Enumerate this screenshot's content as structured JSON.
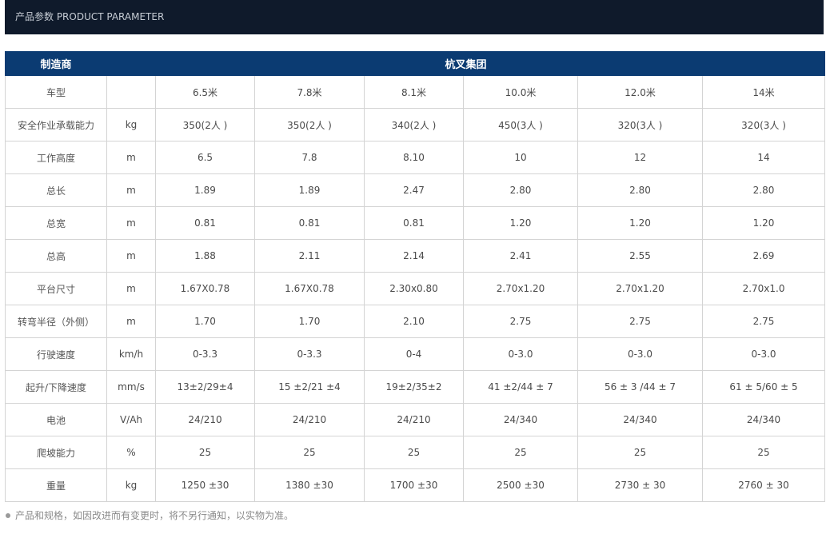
{
  "header": {
    "title": "产品参数 PRODUCT PARAMETER"
  },
  "table": {
    "manufacturer_label": "制造商",
    "manufacturer_value": "杭叉集团",
    "rows": [
      {
        "label": "车型",
        "unit": "",
        "values": [
          "6.5米",
          "7.8米",
          "8.1米",
          "10.0米",
          "12.0米",
          "14米"
        ]
      },
      {
        "label": "安全作业承载能力",
        "unit": "kg",
        "values": [
          "350(2人 )",
          "350(2人 )",
          "340(2人 )",
          "450(3人 )",
          "320(3人 )",
          "320(3人 )"
        ]
      },
      {
        "label": "工作高度",
        "unit": "m",
        "values": [
          "6.5",
          "7.8",
          "8.10",
          "10",
          "12",
          "14"
        ]
      },
      {
        "label": "总长",
        "unit": "m",
        "values": [
          "1.89",
          "1.89",
          "2.47",
          "2.80",
          "2.80",
          "2.80"
        ]
      },
      {
        "label": "总宽",
        "unit": "m",
        "values": [
          "0.81",
          "0.81",
          "0.81",
          "1.20",
          "1.20",
          "1.20"
        ]
      },
      {
        "label": "总高",
        "unit": "m",
        "values": [
          "1.88",
          "2.11",
          "2.14",
          "2.41",
          "2.55",
          "2.69"
        ]
      },
      {
        "label": "平台尺寸",
        "unit": "m",
        "values": [
          "1.67X0.78",
          "1.67X0.78",
          "2.30x0.80",
          "2.70x1.20",
          "2.70x1.20",
          "2.70x1.0"
        ]
      },
      {
        "label": "转弯半径（外侧）",
        "unit": "m",
        "values": [
          "1.70",
          "1.70",
          "2.10",
          "2.75",
          "2.75",
          "2.75"
        ]
      },
      {
        "label": "行驶速度",
        "unit": "km/h",
        "values": [
          "0-3.3",
          "0-3.3",
          "0-4",
          "0-3.0",
          "0-3.0",
          "0-3.0"
        ]
      },
      {
        "label": "起升/下降速度",
        "unit": "mm/s",
        "values": [
          "13±2/29±4",
          "15 ±2/21 ±4",
          "19±2/35±2",
          "41 ±2/44 ± 7",
          "56 ± 3 /44 ± 7",
          "61 ± 5/60 ± 5"
        ]
      },
      {
        "label": "电池",
        "unit": "V/Ah",
        "values": [
          "24/210",
          "24/210",
          "24/210",
          "24/340",
          "24/340",
          "24/340"
        ]
      },
      {
        "label": "爬坡能力",
        "unit": "%",
        "values": [
          "25",
          "25",
          "25",
          "25",
          "25",
          "25"
        ]
      },
      {
        "label": "重量",
        "unit": "kg",
        "values": [
          "1250 ±30",
          "1380 ±30",
          "1700 ±30",
          "2500 ±30",
          "2730 ± 30",
          "2760 ± 30"
        ]
      }
    ]
  },
  "footnote": "产品和规格，如因改进而有变更时，将不另行通知，以实物为准。",
  "colors": {
    "topbar": "#0f1a2b",
    "table_header": "#0b3b72",
    "border": "#d4d4d4",
    "text": "#4a4a4a"
  }
}
